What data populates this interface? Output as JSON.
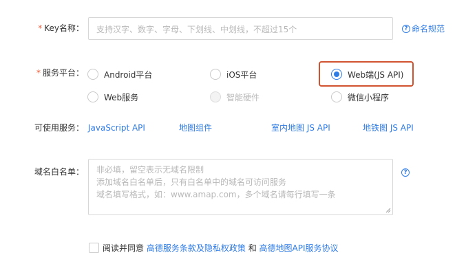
{
  "form": {
    "key_name": {
      "required_mark": "*",
      "label": "Key名称：",
      "placeholder": "支持汉字、数字、字母、下划线、中划线，不超过15个",
      "help_link": "命名规范"
    },
    "platform": {
      "required_mark": "*",
      "label": "服务平台：",
      "options": [
        {
          "label": "Android平台",
          "checked": false,
          "disabled": false
        },
        {
          "label": "iOS平台",
          "checked": false,
          "disabled": false
        },
        {
          "label": "Web端(JS API)",
          "checked": true,
          "disabled": false
        },
        {
          "label": "Web服务",
          "checked": false,
          "disabled": false
        },
        {
          "label": "智能硬件",
          "checked": false,
          "disabled": true
        },
        {
          "label": "微信小程序",
          "checked": false,
          "disabled": false
        }
      ]
    },
    "services": {
      "label": "可使用服务：",
      "items": [
        "JavaScript API",
        "地图组件",
        "室内地图 JS API",
        "地铁图 JS API"
      ]
    },
    "whitelist": {
      "label": "域名白名单：",
      "placeholder_lines": [
        "非必填，留空表示无域名限制",
        "添加域名白名单后，只有白名单中的域名可访问服务",
        "域名填写格式，如：www.amap.com，多个域名请每行填写一条"
      ]
    },
    "agreement": {
      "checked": false,
      "prefix": "阅读并同意",
      "link1": "高德服务条款及隐私权政策",
      "conjunction": "和",
      "link2": "高德地图API服务协议"
    }
  },
  "colors": {
    "accent": "#2f7ce5",
    "required": "#ee5d39",
    "highlight_border": "#d0522e",
    "placeholder": "#b9b9b9"
  }
}
